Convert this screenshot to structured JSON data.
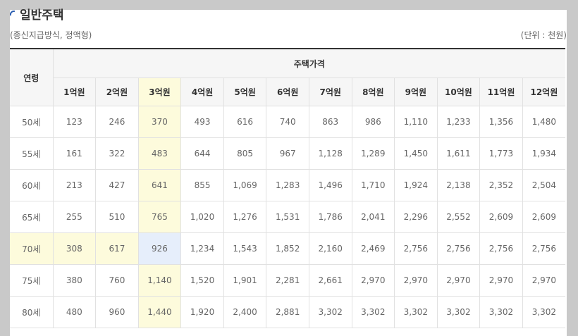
{
  "title": "일반주택",
  "note_left": "(종신지급방식, 정액형)",
  "note_right": "(단위 : 천원)",
  "colors": {
    "header_bg": "#f6f6f6",
    "highlight_yellow": "#fdfbdc",
    "highlight_blue": "#e6eefb"
  },
  "table": {
    "age_header": "연령",
    "group_header": "주택가격",
    "price_headers": [
      "1억원",
      "2억원",
      "3억원",
      "4억원",
      "5억원",
      "6억원",
      "7억원",
      "8억원",
      "9억원",
      "10억원",
      "11억원",
      "12억원"
    ],
    "rows": [
      {
        "age": "50세",
        "values": [
          "123",
          "246",
          "370",
          "493",
          "616",
          "740",
          "863",
          "986",
          "1,110",
          "1,233",
          "1,356",
          "1,480"
        ]
      },
      {
        "age": "55세",
        "values": [
          "161",
          "322",
          "483",
          "644",
          "805",
          "967",
          "1,128",
          "1,289",
          "1,450",
          "1,611",
          "1,773",
          "1,934"
        ]
      },
      {
        "age": "60세",
        "values": [
          "213",
          "427",
          "641",
          "855",
          "1,069",
          "1,283",
          "1,496",
          "1,710",
          "1,924",
          "2,138",
          "2,352",
          "2,504"
        ]
      },
      {
        "age": "65세",
        "values": [
          "255",
          "510",
          "765",
          "1,020",
          "1,276",
          "1,531",
          "1,786",
          "2,041",
          "2,296",
          "2,552",
          "2,609",
          "2,609"
        ]
      },
      {
        "age": "70세",
        "values": [
          "308",
          "617",
          "926",
          "1,234",
          "1,543",
          "1,852",
          "2,160",
          "2,469",
          "2,756",
          "2,756",
          "2,756",
          "2,756"
        ]
      },
      {
        "age": "75세",
        "values": [
          "380",
          "760",
          "1,140",
          "1,520",
          "1,901",
          "2,281",
          "2,661",
          "2,970",
          "2,970",
          "2,970",
          "2,970",
          "2,970"
        ]
      },
      {
        "age": "80세",
        "values": [
          "480",
          "960",
          "1,440",
          "1,920",
          "2,400",
          "2,881",
          "3,302",
          "3,302",
          "3,302",
          "3,302",
          "3,302",
          "3,302"
        ]
      }
    ]
  }
}
